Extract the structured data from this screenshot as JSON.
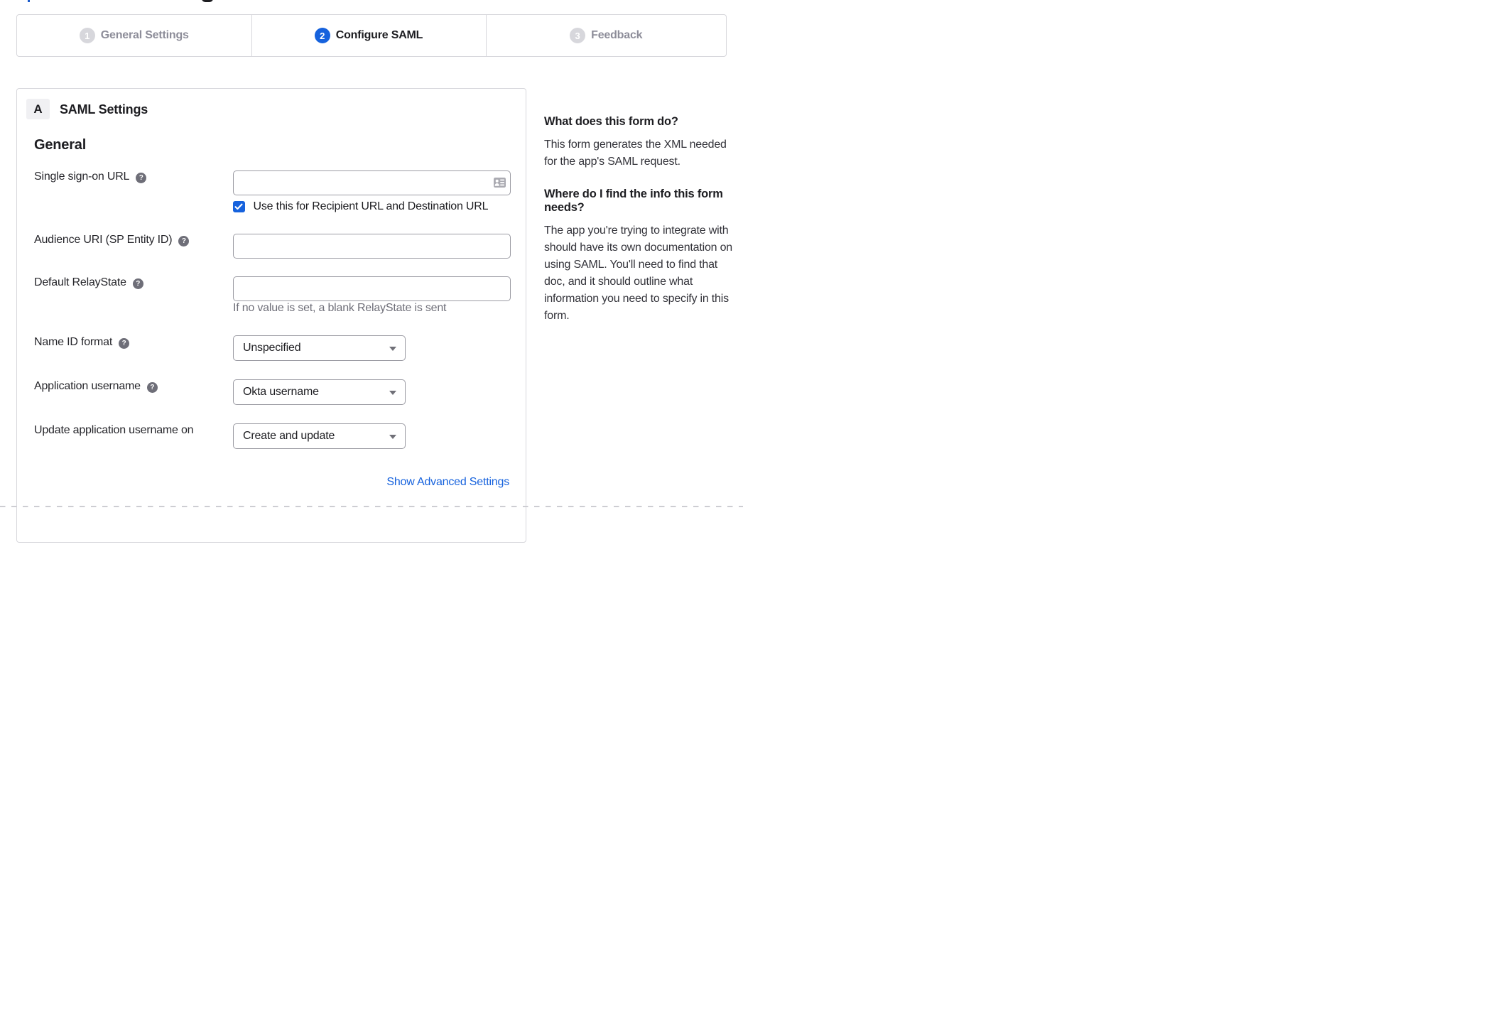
{
  "stepper": {
    "steps": [
      {
        "number": "1",
        "label": "General Settings",
        "state": "inactive"
      },
      {
        "number": "2",
        "label": "Configure SAML",
        "state": "active"
      },
      {
        "number": "3",
        "label": "Feedback",
        "state": "inactive"
      }
    ]
  },
  "panel": {
    "section_badge": "A",
    "section_title": "SAML Settings",
    "group_heading": "General",
    "fields": [
      {
        "label": "Single sign-on URL",
        "type": "text",
        "value": "",
        "checkbox_label": "Use this for Recipient URL and Destination URL",
        "checkbox_checked": true
      },
      {
        "label": "Audience URI (SP Entity ID)",
        "type": "text",
        "value": ""
      },
      {
        "label": "Default RelayState",
        "type": "text",
        "value": "",
        "hint": "If no value is set, a blank RelayState is sent"
      },
      {
        "label": "Name ID format",
        "type": "select",
        "value": "Unspecified"
      },
      {
        "label": "Application username",
        "type": "select",
        "value": "Okta username"
      },
      {
        "label": "Update application username on",
        "type": "select",
        "value": "Create and update"
      }
    ],
    "advanced_link": "Show Advanced Settings"
  },
  "sidebar": {
    "sections": [
      {
        "heading": "What does this form do?",
        "heading_lines": [
          "What does this form do?"
        ],
        "body": "This form generates the XML needed for the app's SAML request.",
        "body_lines": [
          "This form generates the XML needed",
          "for the app's SAML request."
        ]
      },
      {
        "heading": "Where do I find the info this form needs?",
        "heading_lines": [
          "Where do I find the info this form",
          "needs?"
        ],
        "body": "The app you're trying to integrate with should have its own documentation on using SAML. You'll need to find that doc, and it should outline what information you need to specify in this form.",
        "body_lines": [
          "The app you're trying to integrate with",
          "should have its own documentation on",
          "using SAML. You'll need to find that",
          "doc, and it should outline what",
          "information you need to specify in this",
          "form."
        ]
      }
    ]
  },
  "colors": {
    "accent_blue": "#1662dd",
    "border_light": "#d7d7dc",
    "border_input": "#9b9ba3",
    "text_dark": "#1d1d21",
    "text_gray": "#6e6e78",
    "step_inactive_text": "#8d8d99"
  }
}
